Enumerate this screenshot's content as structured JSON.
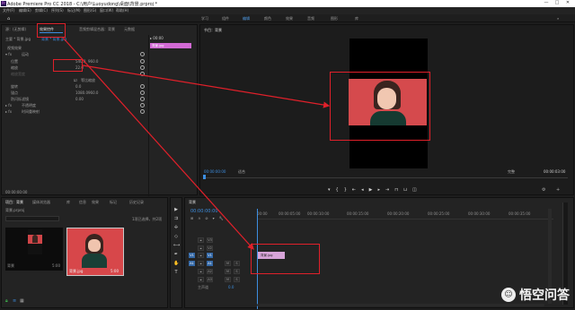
{
  "window": {
    "title": "Adobe Premiere Pro CC 2018 - C:\\用户\\Luoyudong\\桌面\\背景.prproj *",
    "controls": [
      "—",
      "□",
      "✕"
    ]
  },
  "menu": [
    "文件(F)",
    "编辑(E)",
    "剪辑(C)",
    "序列(S)",
    "标记(M)",
    "图形(G)",
    "窗口(W)",
    "帮助(H)"
  ],
  "workspace_tabs": [
    "学习",
    "组件",
    "编辑",
    "颜色",
    "效果",
    "音频",
    "图形",
    "库"
  ],
  "workspace_active": "编辑",
  "effect_controls": {
    "tabs": [
      "源：(无剪辑)",
      "效果控件",
      "音频剪辑混合器：背景",
      "元数据"
    ],
    "active_tab": "效果控件",
    "master_label": "主要 * 背景.jpg",
    "clip_label": "背景 * 背景.jpg",
    "clip_chip": "背景.jpg",
    "section": "视频效果",
    "motion": "运动",
    "rows": [
      {
        "label": "位置",
        "value1": "540.0",
        "value2": "960.0"
      },
      {
        "label": "缩放",
        "value1": "22.0"
      },
      {
        "label": "缩放宽度",
        "value1": ""
      },
      {
        "label": "等比缩放"
      },
      {
        "label": "旋转",
        "value1": "0.0"
      },
      {
        "label": "锚点",
        "value1": "1080.0",
        "value2": "960.0"
      },
      {
        "label": "防闪烁滤镜",
        "value1": "0.00"
      }
    ],
    "opacity": "不透明度",
    "time_remap": "时间重映射",
    "timecode": "00:00:00:00"
  },
  "program_monitor": {
    "title": "节目：背景",
    "timecode_left": "00:00:00:00",
    "fit": "适合",
    "full": "完整",
    "timecode_right": "00:00:03:00"
  },
  "project": {
    "tabs": [
      "项目：背景",
      "媒体浏览器",
      "库",
      "信息",
      "效果",
      "标记",
      "历史记录"
    ],
    "active_tab": "项目：背景",
    "path": "背景.prproj",
    "count": "1项已选择，共2项",
    "items": [
      {
        "name": "背景",
        "duration": "5:00"
      },
      {
        "name": "背景.jpg",
        "duration": "5:00"
      }
    ]
  },
  "timeline": {
    "tab": "背景",
    "timecode": "00:00:00:00",
    "ruler": [
      "00:00",
      "00:00:05:00",
      "00:00:10:00",
      "00:00:15:00",
      "00:00:20:00",
      "00:00:25:00",
      "00:00:30:00",
      "00:00:35:00"
    ],
    "video_tracks": [
      "V3",
      "V2",
      "V1"
    ],
    "audio_tracks": [
      "A1",
      "A2",
      "A3"
    ],
    "master": "主声道",
    "master_value": "0.0",
    "clip_label": "背景.jpg"
  },
  "watermark": {
    "text": "悟空问答"
  },
  "colors": {
    "accent": "#3d8ee0",
    "annotation": "#e0202a",
    "panel": "#232323",
    "background": "#1d1d1d"
  }
}
